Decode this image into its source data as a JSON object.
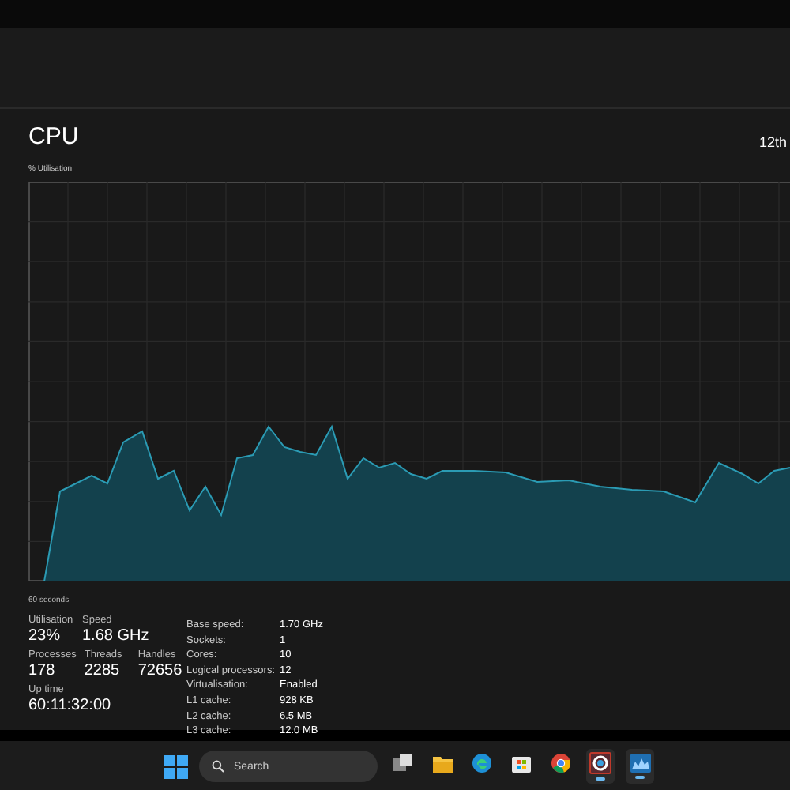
{
  "title": "CPU",
  "processor": "12th",
  "graph_label": "% Utilisation",
  "time_span": "60 seconds",
  "stats": [
    [
      {
        "label": "Utilisation",
        "value": "23%"
      },
      {
        "label": "Speed",
        "value": "1.68 GHz"
      }
    ],
    [
      {
        "label": "Processes",
        "value": "178"
      },
      {
        "label": "Threads",
        "value": "2285"
      },
      {
        "label": "Handles",
        "value": "72656"
      }
    ],
    [
      {
        "label": "Up time",
        "value": "60:11:32:00"
      }
    ]
  ],
  "details": [
    {
      "label": "Base speed:",
      "value": "1.70 GHz"
    },
    {
      "label": "Sockets:",
      "value": "1"
    },
    {
      "label": "Cores:",
      "value": "10"
    },
    {
      "label": "Logical processors:",
      "value": "12"
    },
    {
      "label": "Virtualisation:",
      "value": "Enabled"
    },
    {
      "label": "L1 cache:",
      "value": "928 KB"
    },
    {
      "label": "L2 cache:",
      "value": "6.5 MB"
    },
    {
      "label": "L3 cache:",
      "value": "12.0 MB"
    }
  ],
  "taskbar": {
    "search": {
      "placeholder": "Search"
    },
    "apps": [
      {
        "kind": "taskview",
        "running": false
      },
      {
        "kind": "folder",
        "running": false
      },
      {
        "kind": "edge",
        "running": false
      },
      {
        "kind": "store",
        "running": false
      },
      {
        "kind": "chrome",
        "running": false
      },
      {
        "kind": "ring",
        "running": true
      },
      {
        "kind": "taskmanager",
        "running": true
      }
    ]
  }
}
